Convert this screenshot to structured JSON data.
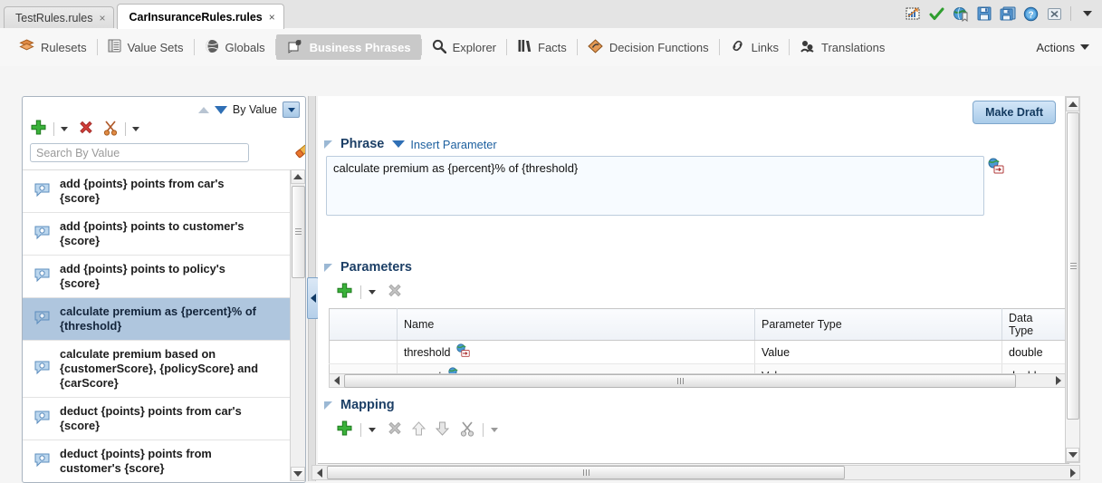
{
  "window": {
    "tabs": [
      {
        "label": "TestRules.rules",
        "active": false,
        "close": "×"
      },
      {
        "label": "CarInsuranceRules.rules",
        "active": true,
        "close": "×"
      }
    ],
    "toolbar_icons": [
      {
        "name": "chart-grid-icon",
        "title": "Run"
      },
      {
        "name": "checkmark-icon",
        "title": "Validate"
      },
      {
        "name": "globe-bookmark-icon",
        "title": "Globe"
      },
      {
        "name": "save-icon",
        "title": "Save"
      },
      {
        "name": "save-all-icon",
        "title": "Save All"
      },
      {
        "name": "help-icon",
        "title": "Help"
      },
      {
        "name": "close-icon",
        "title": "Close"
      },
      {
        "name": "chevron-down-icon",
        "title": "More"
      }
    ]
  },
  "navbar": {
    "items": [
      {
        "label": "Rulesets",
        "icon": "rulesets-icon",
        "active": false
      },
      {
        "label": "Value Sets",
        "icon": "valuesets-icon",
        "active": false
      },
      {
        "label": "Globals",
        "icon": "globals-icon",
        "active": false
      },
      {
        "label": "Business Phrases",
        "icon": "business-phrases-icon",
        "active": true
      },
      {
        "label": "Explorer",
        "icon": "search-icon",
        "active": false
      },
      {
        "label": "Facts",
        "icon": "facts-icon",
        "active": false
      },
      {
        "label": "Decision Functions",
        "icon": "decision-functions-icon",
        "active": false
      },
      {
        "label": "Links",
        "icon": "links-icon",
        "active": false
      },
      {
        "label": "Translations",
        "icon": "translations-icon",
        "active": false
      }
    ],
    "actions_label": "Actions"
  },
  "left_panel": {
    "sort_label": "By Value",
    "search_placeholder": "Search By Value",
    "search_value": "",
    "toolbar": [
      {
        "name": "add-button",
        "icon": "plus-green-icon"
      },
      {
        "name": "add-dropdown",
        "icon": "caret-down-icon"
      },
      {
        "name": "delete-button",
        "icon": "x-red-icon"
      },
      {
        "name": "cut-button",
        "icon": "scissors-icon"
      },
      {
        "name": "cut-dropdown",
        "icon": "caret-down-icon"
      }
    ],
    "eraser_icon": "eraser-icon",
    "items": [
      {
        "label": "add {points} points from car's {score}",
        "selected": false
      },
      {
        "label": "add {points} points to customer's {score}",
        "selected": false
      },
      {
        "label": "add {points} points to policy's {score}",
        "selected": false
      },
      {
        "label": "calculate premium as {percent}% of {threshold}",
        "selected": true
      },
      {
        "label": "calculate premium based on {customerScore}, {policyScore} and {carScore}",
        "selected": false
      },
      {
        "label": "deduct {points} points from car's {score}",
        "selected": false
      },
      {
        "label": "deduct {points} points from customer's {score}",
        "selected": false
      }
    ]
  },
  "main": {
    "make_draft_label": "Make Draft",
    "phrase": {
      "title": "Phrase",
      "insert_parameter_label": "Insert Parameter",
      "value": "calculate premium as {percent}% of {threshold}",
      "link_icon": "globe-link-icon"
    },
    "parameters": {
      "title": "Parameters",
      "toolbar": [
        {
          "name": "add-parameter-button",
          "icon": "plus-green-icon"
        },
        {
          "name": "add-parameter-dropdown",
          "icon": "caret-down-icon"
        },
        {
          "name": "delete-parameter-button",
          "icon": "x-grey-icon"
        }
      ],
      "columns": [
        "",
        "Name",
        "Parameter Type",
        "Data Type"
      ],
      "rows": [
        {
          "name": "threshold",
          "parameter_type": "Value",
          "data_type": "double",
          "icon": "globe-link-icon"
        },
        {
          "name": "percent",
          "parameter_type": "Value",
          "data_type": "double",
          "icon": "globe-link-icon"
        }
      ]
    },
    "mapping": {
      "title": "Mapping",
      "toolbar": [
        {
          "name": "add-mapping-button",
          "icon": "plus-green-icon"
        },
        {
          "name": "add-mapping-dropdown",
          "icon": "caret-down-icon"
        },
        {
          "name": "delete-mapping-button",
          "icon": "x-grey-icon"
        },
        {
          "name": "move-up-button",
          "icon": "arrow-up-icon"
        },
        {
          "name": "move-down-button",
          "icon": "arrow-down-icon"
        },
        {
          "name": "cut-mapping-button",
          "icon": "scissors-grey-icon"
        },
        {
          "name": "cut-mapping-dropdown",
          "icon": "caret-down-icon"
        }
      ]
    }
  },
  "colors": {
    "accent": "#1c5f9e",
    "selection": "#afc6de",
    "active_tab_nav": "#c9c9c9",
    "section_title": "#1c3f66",
    "draft_button": "#a9cbe9"
  }
}
